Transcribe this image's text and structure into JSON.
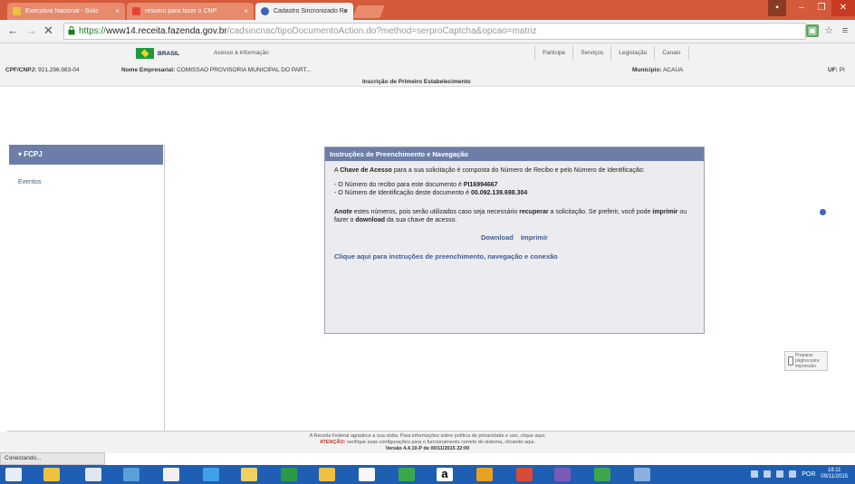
{
  "browser": {
    "tabs": [
      {
        "title": "Executiva Nacional - Solic",
        "active": false,
        "icon_color": "#f0c040"
      },
      {
        "title": "resumo para fazer o CNP",
        "active": false,
        "icon_color": "#ea4335"
      },
      {
        "title": "Cadastro Sincronizado Re",
        "active": true,
        "icon_color": "#3e64b4"
      }
    ],
    "url": {
      "scheme": "https://",
      "host": "www14.receita.fazenda.gov.br",
      "path": "/cadsincnac/tipoDocumentoAction.do?method=serproCaptcha&opcao=matriz"
    }
  },
  "site": {
    "brasil_label": "BRASIL",
    "acesso_label": "Acesso à informação",
    "gov_links": [
      "Participe",
      "Serviços",
      "Legislação",
      "Canais"
    ],
    "cpf_label": "CPF/CNPJ:",
    "cpf_value": "921.296.983-04",
    "nome_label": "Nome Empresarial:",
    "nome_value": "COMISSAO PROVISORIA MUNICIPAL DO PART...",
    "municipio_label": "Municipio:",
    "municipio_value": "ACAUA",
    "uf_label": "UF:",
    "uf_value": "PI",
    "inscricao_title": "Inscrição de Primeiro Estabelecimento"
  },
  "sidebar": {
    "header": "FCPJ",
    "items": [
      "Eventos"
    ]
  },
  "dialog": {
    "title": "Instruções de Preenchimento e Navegação",
    "intro_pre": "A ",
    "intro_bold": "Chave de Acesso",
    "intro_post": " para a sua solicitação é composta do Número de Recibo e pelo Número de Identificação:",
    "recibo_text": "- O Número do recibo para este documento é ",
    "recibo_value": "PI16994667",
    "ident_text": "- O Número de Identificação deste documento é ",
    "ident_value": "00.092.139.698.304",
    "note_bold1": "Anote",
    "note_text1": " estes números, pois serão utilizados caso seja necessário ",
    "note_bold2": "recuperar",
    "note_text2": " a solicitação. Se preferir, você pode ",
    "note_bold3": "imprimir",
    "note_text3": " ou fazer o ",
    "note_bold4": "download",
    "note_text4": " da sua chave de acesso.",
    "download_label": "Download",
    "imprimir_label": "Imprimir",
    "instructions_link": "Clique aqui para instruções de preenchimento, navegação e conexão"
  },
  "print_page": "Preparar página para impressão",
  "footer": {
    "line1": "A Receita Federal agradece a sua visita. Para informações sobre política de privacidade e uso, clique aqui.",
    "warn_label": "ATENÇÃO:",
    "line2": " verifique suas configurações para o funcionamento correto do sistema, clicando aqui.",
    "version": "Versão 4.4.10-P de 00/11/2015 22:00"
  },
  "status": "Conectando...",
  "taskbar": {
    "lang": "POR",
    "time": "18:11",
    "date": "09/11/2015"
  },
  "colors": {
    "accent": "#6c7ea8",
    "link": "#3f5c8f",
    "tabbar": "#d35a3a",
    "taskbar": "#1f5fb3"
  }
}
